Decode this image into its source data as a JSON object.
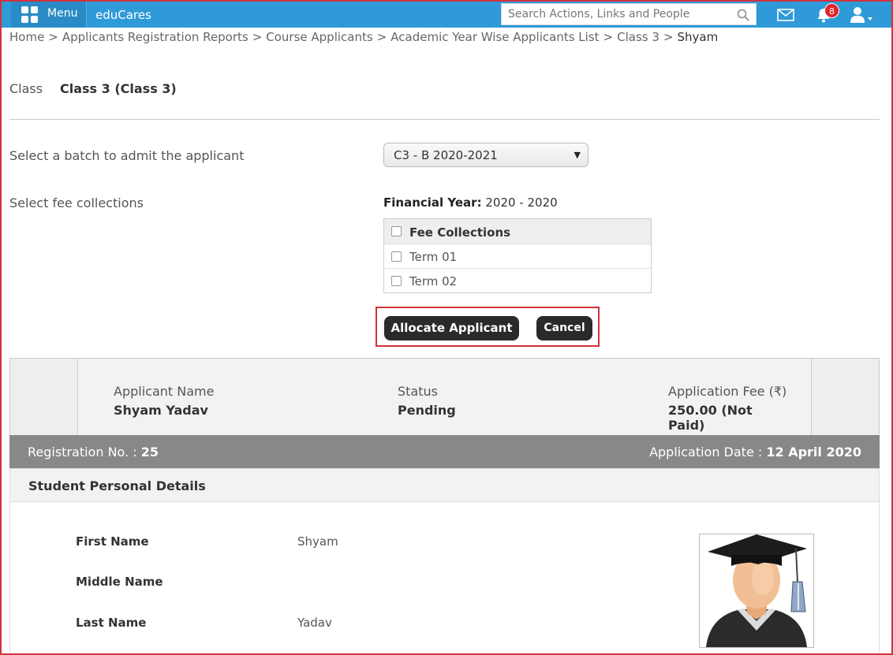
{
  "header": {
    "menu_label": "Menu",
    "brand": "eduCares",
    "search_placeholder": "Search Actions, Links and People",
    "notification_count": "8"
  },
  "breadcrumb": [
    "Home",
    "Applicants Registration Reports",
    "Course Applicants",
    "Academic Year Wise Applicants List",
    "Class 3",
    "Shyam"
  ],
  "class_section": {
    "label": "Class",
    "value": "Class 3 (Class 3)"
  },
  "batch": {
    "label": "Select a batch to admit the applicant",
    "selected": "C3 - B 2020-2021"
  },
  "fees": {
    "label": "Select fee collections",
    "financial_year_label": "Financial Year:",
    "financial_year_value": "2020 - 2020",
    "header": "Fee Collections",
    "items": [
      "Term 01",
      "Term 02"
    ]
  },
  "actions": {
    "allocate": "Allocate Applicant",
    "cancel": "Cancel"
  },
  "summary": {
    "name_label": "Applicant Name",
    "name_value": "Shyam Yadav",
    "status_label": "Status",
    "status_value": "Pending",
    "fee_label": "Application Fee (₹)",
    "fee_value_line1": "250.00 (Not",
    "fee_value_line2": "Paid)"
  },
  "registration": {
    "reg_label": "Registration No. :",
    "reg_value": "25",
    "date_label": "Application Date :",
    "date_value": "12 April 2020"
  },
  "personal": {
    "title": "Student Personal Details",
    "fields": [
      {
        "label": "First Name",
        "value": "Shyam"
      },
      {
        "label": "Middle Name",
        "value": ""
      },
      {
        "label": "Last Name",
        "value": "Yadav"
      }
    ]
  },
  "colors": {
    "topbar": "#2f9ad8",
    "highlight": "#d0323c",
    "button": "#2a2a2a",
    "regbar": "#888888"
  }
}
